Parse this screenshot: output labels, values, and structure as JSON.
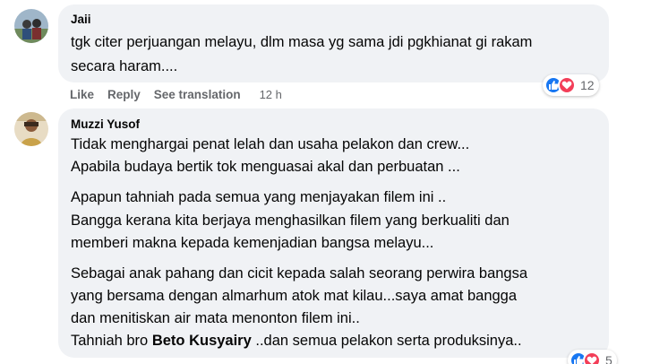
{
  "comments": [
    {
      "author": "Jaii",
      "lines": [
        "tgk citer perjuangan melayu, dlm masa yg sama jdi pgkhianat gi rakam",
        "secara haram...."
      ],
      "actions": {
        "like": "Like",
        "reply": "Reply",
        "translate": "See translation",
        "time": "12 h"
      },
      "reactions": {
        "types": [
          "like-icon",
          "love-icon"
        ],
        "count": "12"
      }
    },
    {
      "author": "Muzzi Yusof",
      "lines": [
        "Tidak menghargai penat lelah dan usaha pelakon dan crew...",
        "Apabila budaya bertik tok menguasai akal dan perbuatan ...",
        "Apapun tahniah pada semua yang menjayakan filem ini ..",
        "Bangga kerana kita berjaya menghasilkan filem yang berkualiti dan",
        "memberi makna kepada kemenjadian bangsa melayu...",
        "Sebagai anak pahang dan cicit kepada salah seorang perwira bangsa",
        "yang bersama dengan almarhum atok mat kilau...saya amat bangga",
        "dan menitiskan air mata menonton filem ini..",
        "Tahniah bro ",
        "Beto Kusyairy",
        " ..dan semua pelakon serta produksinya.."
      ],
      "reactions": {
        "types": [
          "like-icon",
          "love-icon"
        ],
        "count": "5"
      }
    }
  ],
  "colors": {
    "bubble": "#f0f2f5",
    "meta": "#65676b",
    "like": "#1877f2",
    "love": "#f33e58"
  }
}
